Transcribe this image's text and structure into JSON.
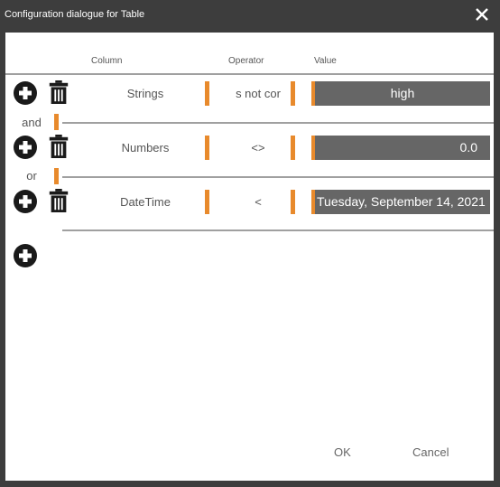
{
  "window": {
    "title": "Configuration dialogue for Table",
    "close_icon": "close-icon"
  },
  "headers": {
    "column": "Column",
    "operator": "Operator",
    "value": "Value"
  },
  "conditions": [
    {
      "column": "Strings",
      "operator": "s not cor",
      "value": "high",
      "value_align": "center"
    },
    {
      "column": "Numbers",
      "operator": "<>",
      "value": "0.0",
      "value_align": "right"
    },
    {
      "column": "DateTime",
      "operator": "<",
      "value": "Tuesday, September 14, 2021",
      "value_align": "left"
    }
  ],
  "connectors": [
    "and",
    "or"
  ],
  "icons": {
    "add": "add-circle-icon",
    "delete": "trash-icon"
  },
  "buttons": {
    "ok": "OK",
    "cancel": "Cancel"
  },
  "colors": {
    "accent": "#e88a2c",
    "frame": "#3d3d3d",
    "value_bg": "#666666"
  }
}
